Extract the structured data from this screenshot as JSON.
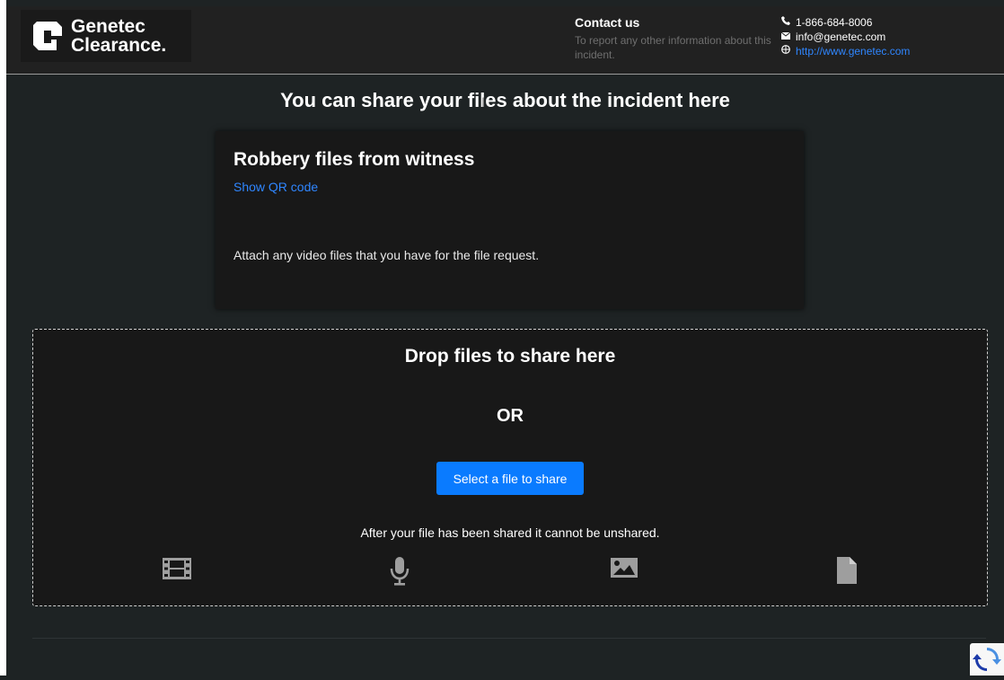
{
  "header": {
    "logo": {
      "line1": "Genetec",
      "line2": "Clearance."
    },
    "contact": {
      "title": "Contact us",
      "description": "To report any other information about this incident.",
      "phone": "1-866-684-8006",
      "email": "info@genetec.com",
      "website": "http://www.genetec.com"
    }
  },
  "main": {
    "title": "You can share your files about the incident here",
    "request": {
      "title": "Robbery files from witness",
      "qr_link": "Show QR code",
      "description": "Attach any video files that you have for the file request."
    },
    "dropzone": {
      "title": "Drop files to share here",
      "or": "OR",
      "button": "Select a file to share",
      "note": "After your file has been shared it cannot be unshared.",
      "icons": [
        "film-icon",
        "microphone-icon",
        "image-icon",
        "document-icon"
      ]
    }
  },
  "colors": {
    "background": "#1e2324",
    "header": "#212121",
    "card": "#181818",
    "accent": "#0a7bff",
    "link": "#2f86ff",
    "icon": "#9e9e9e"
  }
}
